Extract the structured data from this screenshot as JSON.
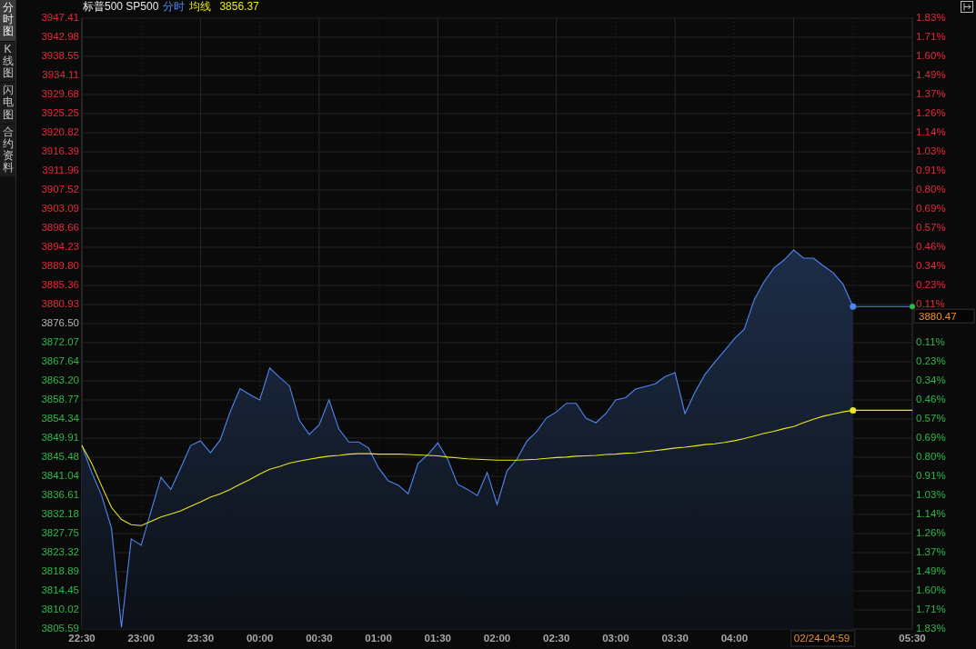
{
  "side_tabs": [
    {
      "label": "分时图",
      "selected": true
    },
    {
      "label": "K线图",
      "selected": false
    },
    {
      "label": "闪电图",
      "selected": false
    },
    {
      "label": "合约资料",
      "selected": false
    }
  ],
  "header": {
    "name": "标普500 SP500",
    "avg_value": "3856.37"
  },
  "chart": {
    "chart_data": {
      "type": "line",
      "categories": [
        "22:30",
        null,
        null,
        null,
        null,
        null,
        "23:00",
        null,
        null,
        null,
        null,
        null,
        "23:30",
        null,
        null,
        null,
        null,
        null,
        "00:00",
        null,
        null,
        null,
        null,
        null,
        "00:30",
        null,
        null,
        null,
        null,
        null,
        "01:00",
        null,
        null,
        null,
        null,
        null,
        "01:30",
        null,
        null,
        null,
        null,
        null,
        "02:00",
        null,
        null,
        null,
        null,
        null,
        "02:30",
        null,
        null,
        null,
        null,
        null,
        "03:00",
        null,
        null,
        null,
        null,
        null,
        "03:30",
        null,
        null,
        null,
        null,
        null,
        "04:00",
        null,
        null,
        null,
        null,
        null,
        null,
        null,
        null,
        null,
        null,
        null,
        null,
        null,
        null,
        null,
        null,
        null,
        "05:30"
      ],
      "series": [
        {
          "name": "分时",
          "type": "area",
          "color": "#4f87f2",
          "values": [
            3848.2,
            3841.9,
            3836.6,
            3829.0,
            3806.0,
            3826.5,
            3825.0,
            3833.0,
            3840.8,
            3838.0,
            3843.0,
            3848.2,
            3849.3,
            3846.5,
            3849.5,
            3856.0,
            3861.4,
            3860.0,
            3858.8,
            3866.2,
            3864.0,
            3862.0,
            3854.0,
            3850.8,
            3853.0,
            3858.8,
            3852.0,
            3849.0,
            3849.0,
            3847.6,
            3843.0,
            3840.0,
            3839.0,
            3837.0,
            3844.0,
            3846.1,
            3848.8,
            3845.0,
            3839.2,
            3838.0,
            3836.6,
            3841.9,
            3834.5,
            3842.3,
            3845.0,
            3849.2,
            3851.4,
            3854.6,
            3856.0,
            3858.0,
            3858.0,
            3854.5,
            3853.5,
            3855.6,
            3858.8,
            3859.3,
            3861.3,
            3861.9,
            3862.5,
            3864.2,
            3865.1,
            3855.6,
            3860.5,
            3864.6,
            3867.5,
            3870.2,
            3873.0,
            3875.2,
            3882.0,
            3886.2,
            3889.4,
            3891.2,
            3893.6,
            3891.7,
            3891.7,
            3889.9,
            3888.3,
            3885.6,
            3880.47,
            null,
            null,
            null,
            null,
            null,
            null
          ]
        },
        {
          "name": "均线",
          "type": "line",
          "color": "#e8e81a",
          "values": [
            3848.2,
            3844.0,
            3838.8,
            3833.8,
            3831.0,
            3829.8,
            3829.6,
            3830.6,
            3831.6,
            3832.3,
            3833.0,
            3834.1,
            3835.1,
            3836.2,
            3837.0,
            3838.0,
            3839.2,
            3840.3,
            3841.6,
            3842.7,
            3843.3,
            3844.1,
            3844.6,
            3845.0,
            3845.4,
            3845.7,
            3845.9,
            3846.2,
            3846.3,
            3846.3,
            3846.2,
            3846.2,
            3846.2,
            3846.1,
            3846.0,
            3845.9,
            3845.8,
            3845.5,
            3845.3,
            3845.1,
            3845.0,
            3844.9,
            3844.8,
            3844.8,
            3844.8,
            3844.9,
            3845.0,
            3845.2,
            3845.4,
            3845.5,
            3845.7,
            3845.8,
            3845.9,
            3846.1,
            3846.2,
            3846.4,
            3846.5,
            3846.8,
            3847.0,
            3847.3,
            3847.6,
            3847.8,
            3848.1,
            3848.4,
            3848.6,
            3848.9,
            3849.3,
            3849.8,
            3850.4,
            3851.0,
            3851.5,
            3852.1,
            3852.6,
            3853.5,
            3854.3,
            3855.0,
            3855.5,
            3856.0,
            3856.37,
            null,
            null,
            null,
            null,
            null,
            null
          ]
        }
      ],
      "ylim": [
        3805.59,
        3947.41
      ],
      "grid": true,
      "yticks": [
        {
          "value": 3947.41,
          "label": "3947.41"
        },
        {
          "value": 3942.98,
          "label": "3942.98"
        },
        {
          "value": 3938.55,
          "label": "3938.55"
        },
        {
          "value": 3934.11,
          "label": "3934.11"
        },
        {
          "value": 3929.68,
          "label": "3929.68"
        },
        {
          "value": 3925.25,
          "label": "3925.25"
        },
        {
          "value": 3920.82,
          "label": "3920.82"
        },
        {
          "value": 3916.39,
          "label": "3916.39"
        },
        {
          "value": 3911.96,
          "label": "3911.96"
        },
        {
          "value": 3907.52,
          "label": "3907.52"
        },
        {
          "value": 3903.09,
          "label": "3903.09"
        },
        {
          "value": 3898.66,
          "label": "3898.66"
        },
        {
          "value": 3894.23,
          "label": "3894.23"
        },
        {
          "value": 3889.8,
          "label": "3889.80"
        },
        {
          "value": 3885.36,
          "label": "3885.36"
        },
        {
          "value": 3880.93,
          "label": "3880.93"
        },
        {
          "value": 3876.5,
          "label": "3876.50"
        },
        {
          "value": 3872.07,
          "label": "3872.07"
        },
        {
          "value": 3867.64,
          "label": "3867.64"
        },
        {
          "value": 3863.2,
          "label": "3863.20"
        },
        {
          "value": 3858.77,
          "label": "3858.77"
        },
        {
          "value": 3854.34,
          "label": "3854.34"
        },
        {
          "value": 3849.91,
          "label": "3849.91"
        },
        {
          "value": 3845.48,
          "label": "3845.48"
        },
        {
          "value": 3841.04,
          "label": "3841.04"
        },
        {
          "value": 3836.61,
          "label": "3836.61"
        },
        {
          "value": 3832.18,
          "label": "3832.18"
        },
        {
          "value": 3827.75,
          "label": "3827.75"
        },
        {
          "value": 3823.32,
          "label": "3823.32"
        },
        {
          "value": 3818.89,
          "label": "3818.89"
        },
        {
          "value": 3814.45,
          "label": "3814.45"
        },
        {
          "value": 3810.02,
          "label": "3810.02"
        },
        {
          "value": 3805.59,
          "label": "3805.59"
        }
      ]
    },
    "percent_ticks": [
      {
        "label": "1.83%",
        "kind": "up"
      },
      {
        "label": "1.71%",
        "kind": "up"
      },
      {
        "label": "1.60%",
        "kind": "up"
      },
      {
        "label": "1.49%",
        "kind": "up"
      },
      {
        "label": "1.37%",
        "kind": "up"
      },
      {
        "label": "1.26%",
        "kind": "up"
      },
      {
        "label": "1.14%",
        "kind": "up"
      },
      {
        "label": "1.03%",
        "kind": "up"
      },
      {
        "label": "0.91%",
        "kind": "up"
      },
      {
        "label": "0.80%",
        "kind": "up"
      },
      {
        "label": "0.69%",
        "kind": "up"
      },
      {
        "label": "0.57%",
        "kind": "up"
      },
      {
        "label": "0.46%",
        "kind": "up"
      },
      {
        "label": "0.34%",
        "kind": "up"
      },
      {
        "label": "0.23%",
        "kind": "up"
      },
      {
        "label": "0.11%",
        "kind": "up"
      },
      {
        "label": "0.11%",
        "kind": "down"
      },
      {
        "label": "0.23%",
        "kind": "down"
      },
      {
        "label": "0.34%",
        "kind": "down"
      },
      {
        "label": "0.46%",
        "kind": "down"
      },
      {
        "label": "0.57%",
        "kind": "down"
      },
      {
        "label": "0.69%",
        "kind": "down"
      },
      {
        "label": "0.80%",
        "kind": "down"
      },
      {
        "label": "0.91%",
        "kind": "down"
      },
      {
        "label": "1.03%",
        "kind": "down"
      },
      {
        "label": "1.14%",
        "kind": "down"
      },
      {
        "label": "1.26%",
        "kind": "down"
      },
      {
        "label": "1.37%",
        "kind": "down"
      },
      {
        "label": "1.49%",
        "kind": "down"
      },
      {
        "label": "1.60%",
        "kind": "down"
      },
      {
        "label": "1.71%",
        "kind": "down"
      },
      {
        "label": "1.83%",
        "kind": "down"
      }
    ],
    "last_price": "3880.47",
    "cursor_time": "02/24-04:59"
  }
}
